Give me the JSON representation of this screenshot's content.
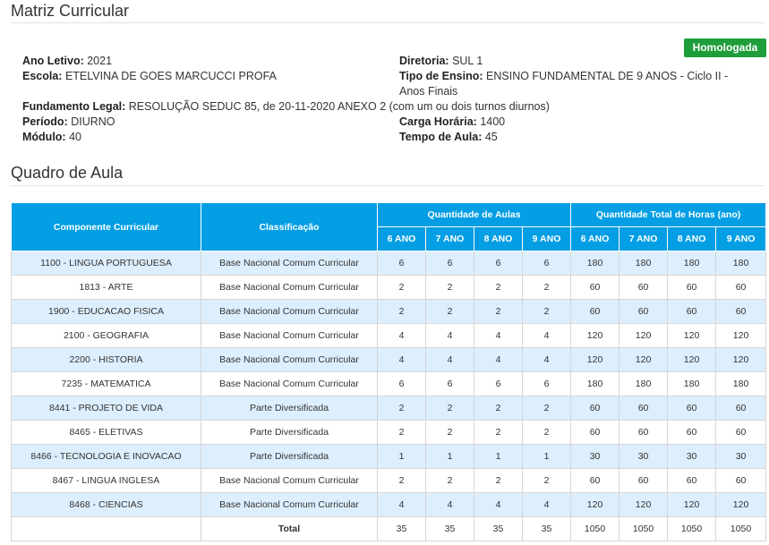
{
  "header": {
    "title": "Matriz Curricular",
    "status_badge": "Homologada"
  },
  "info": {
    "ano_letivo": {
      "label": "Ano Letivo:",
      "value": "2021"
    },
    "escola": {
      "label": "Escola:",
      "value": "ETELVINA DE GOES MARCUCCI PROFA"
    },
    "fundamento_legal": {
      "label": "Fundamento Legal:",
      "value": "RESOLUÇÃO SEDUC 85, de 20-11-2020 ANEXO 2 (com um ou dois turnos diurnos)"
    },
    "periodo": {
      "label": "Período:",
      "value": "DIURNO"
    },
    "modulo": {
      "label": "Módulo:",
      "value": "40"
    },
    "diretoria": {
      "label": "Diretoria:",
      "value": "SUL 1"
    },
    "tipo_ensino": {
      "label": "Tipo de Ensino:",
      "value": "ENSINO FUNDAMENTAL DE 9 ANOS - Ciclo II - Anos Finais"
    },
    "carga_horaria": {
      "label": "Carga Horária:",
      "value": "1400"
    },
    "tempo_aula": {
      "label": "Tempo de Aula:",
      "value": "45"
    }
  },
  "quadro": {
    "title": "Quadro de Aula",
    "headers": {
      "componente": "Componente Curricular",
      "classificacao": "Classificação",
      "qtd_aulas": "Quantidade de Aulas",
      "qtd_horas": "Quantidade Total de Horas (ano)",
      "anos": [
        "6 ANO",
        "7 ANO",
        "8 ANO",
        "9 ANO"
      ]
    },
    "rows": [
      {
        "componente": "1100 - LINGUA PORTUGUESA",
        "classificacao": "Base Nacional Comum Curricular",
        "aulas": [
          "6",
          "6",
          "6",
          "6"
        ],
        "horas": [
          "180",
          "180",
          "180",
          "180"
        ]
      },
      {
        "componente": "1813 - ARTE",
        "classificacao": "Base Nacional Comum Curricular",
        "aulas": [
          "2",
          "2",
          "2",
          "2"
        ],
        "horas": [
          "60",
          "60",
          "60",
          "60"
        ]
      },
      {
        "componente": "1900 - EDUCACAO FISICA",
        "classificacao": "Base Nacional Comum Curricular",
        "aulas": [
          "2",
          "2",
          "2",
          "2"
        ],
        "horas": [
          "60",
          "60",
          "60",
          "60"
        ]
      },
      {
        "componente": "2100 - GEOGRAFIA",
        "classificacao": "Base Nacional Comum Curricular",
        "aulas": [
          "4",
          "4",
          "4",
          "4"
        ],
        "horas": [
          "120",
          "120",
          "120",
          "120"
        ]
      },
      {
        "componente": "2200 - HISTORIA",
        "classificacao": "Base Nacional Comum Curricular",
        "aulas": [
          "4",
          "4",
          "4",
          "4"
        ],
        "horas": [
          "120",
          "120",
          "120",
          "120"
        ]
      },
      {
        "componente": "7235 - MATEMATICA",
        "classificacao": "Base Nacional Comum Curricular",
        "aulas": [
          "6",
          "6",
          "6",
          "6"
        ],
        "horas": [
          "180",
          "180",
          "180",
          "180"
        ]
      },
      {
        "componente": "8441 - PROJETO DE VIDA",
        "classificacao": "Parte Diversificada",
        "aulas": [
          "2",
          "2",
          "2",
          "2"
        ],
        "horas": [
          "60",
          "60",
          "60",
          "60"
        ]
      },
      {
        "componente": "8465 - ELETIVAS",
        "classificacao": "Parte Diversificada",
        "aulas": [
          "2",
          "2",
          "2",
          "2"
        ],
        "horas": [
          "60",
          "60",
          "60",
          "60"
        ]
      },
      {
        "componente": "8466 - TECNOLOGIA E INOVACAO",
        "classificacao": "Parte Diversificada",
        "aulas": [
          "1",
          "1",
          "1",
          "1"
        ],
        "horas": [
          "30",
          "30",
          "30",
          "30"
        ]
      },
      {
        "componente": "8467 - LINGUA INGLESA",
        "classificacao": "Base Nacional Comum Curricular",
        "aulas": [
          "2",
          "2",
          "2",
          "2"
        ],
        "horas": [
          "60",
          "60",
          "60",
          "60"
        ]
      },
      {
        "componente": "8468 - CIENCIAS",
        "classificacao": "Base Nacional Comum Curricular",
        "aulas": [
          "4",
          "4",
          "4",
          "4"
        ],
        "horas": [
          "120",
          "120",
          "120",
          "120"
        ]
      }
    ],
    "total": {
      "label": "Total",
      "aulas": [
        "35",
        "35",
        "35",
        "35"
      ],
      "horas": [
        "1050",
        "1050",
        "1050",
        "1050"
      ]
    }
  },
  "colors": {
    "header_bg": "#039ee3",
    "row_alt_bg": "#ddeefc",
    "badge_bg": "#1e9e3a"
  }
}
